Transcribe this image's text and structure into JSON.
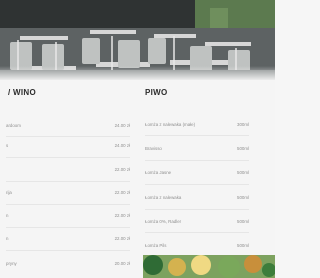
{
  "photo": {
    "icon": "restaurant-terrace-photo"
  },
  "left_column": {
    "title": "/ WINO",
    "items": [
      {
        "name": "ardoom",
        "price": "24.00 zł"
      },
      {
        "name": "s",
        "price": "24.00 zł"
      },
      {
        "name": "",
        "price": "22.00 zł"
      },
      {
        "name": "rija",
        "price": "22.00 zł"
      },
      {
        "name": "n",
        "price": "22.00 zł"
      },
      {
        "name": "n",
        "price": "22.00 zł"
      },
      {
        "name": "pryny",
        "price": "20.00 zł"
      }
    ]
  },
  "right_column": {
    "title": "PIWO",
    "items": [
      {
        "name": "Łomża z nalewaka (małe)",
        "price": "300ml"
      },
      {
        "name": "Bravisso",
        "price": "500ml"
      },
      {
        "name": "Łomża Jasne",
        "price": "500ml"
      },
      {
        "name": "Łomża z nalewaka",
        "price": "500ml"
      },
      {
        "name": "Łomża 0%, Radler",
        "price": "500ml"
      },
      {
        "name": "Łomża Pils",
        "price": "500ml"
      }
    ]
  },
  "bottom_photo": {
    "icon": "food-photo"
  }
}
